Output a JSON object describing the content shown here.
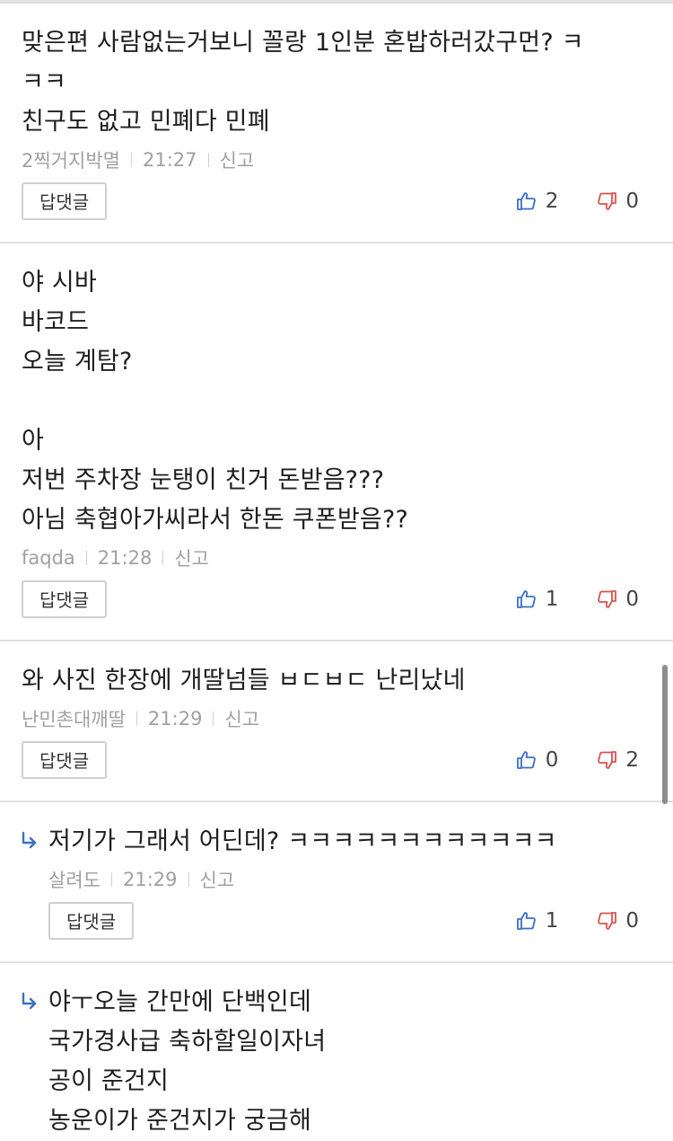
{
  "comments": [
    {
      "reply": false,
      "lines": [
        "맞은편 사람없는거보니 꼴랑 1인분 혼밥하러갔구먼? ㅋ",
        "ㅋㅋ",
        "친구도 없고 민폐다 민폐"
      ],
      "author": "2찍거지박멸",
      "time": "21:27",
      "report": "신고",
      "reply_label": "답댓글",
      "likes": "2",
      "dislikes": "0"
    },
    {
      "reply": false,
      "lines": [
        "야 시바",
        "바코드",
        "오늘 계탐?",
        "",
        "아",
        "저번 주차장 눈탱이 친거 돈받음???",
        "아님 축협아가씨라서 한돈 쿠폰받음??"
      ],
      "author": "faqda",
      "time": "21:28",
      "report": "신고",
      "reply_label": "답댓글",
      "likes": "1",
      "dislikes": "0"
    },
    {
      "reply": false,
      "lines": [
        "와 사진 한장에 개딸넘들 ㅂㄷㅂㄷ 난리났네"
      ],
      "author": "난민촌대깨딸",
      "time": "21:29",
      "report": "신고",
      "reply_label": "답댓글",
      "likes": "0",
      "dislikes": "2"
    },
    {
      "reply": true,
      "lines": [
        "저기가 그래서 어딘데? ㅋㅋㅋㅋㅋㅋㅋㅋㅋㅋㅋㅋ"
      ],
      "author": "살려도",
      "time": "21:29",
      "report": "신고",
      "reply_label": "답댓글",
      "likes": "1",
      "dislikes": "0"
    },
    {
      "reply": true,
      "lines": [
        "야ㅜ오늘 간만에 단백인데",
        "국가경사급 축하할일이자녀",
        "공이 준건지",
        "농운이가 준건지가 궁금해"
      ],
      "partial": true
    }
  ],
  "colors": {
    "accent_blue": "#3b6fc6",
    "dislike_red": "#d9534f",
    "meta_gray": "#a0a0a0"
  },
  "icons": {
    "like": "thumbs-up-icon",
    "dislike": "thumbs-down-icon",
    "reply": "reply-arrow-icon"
  }
}
